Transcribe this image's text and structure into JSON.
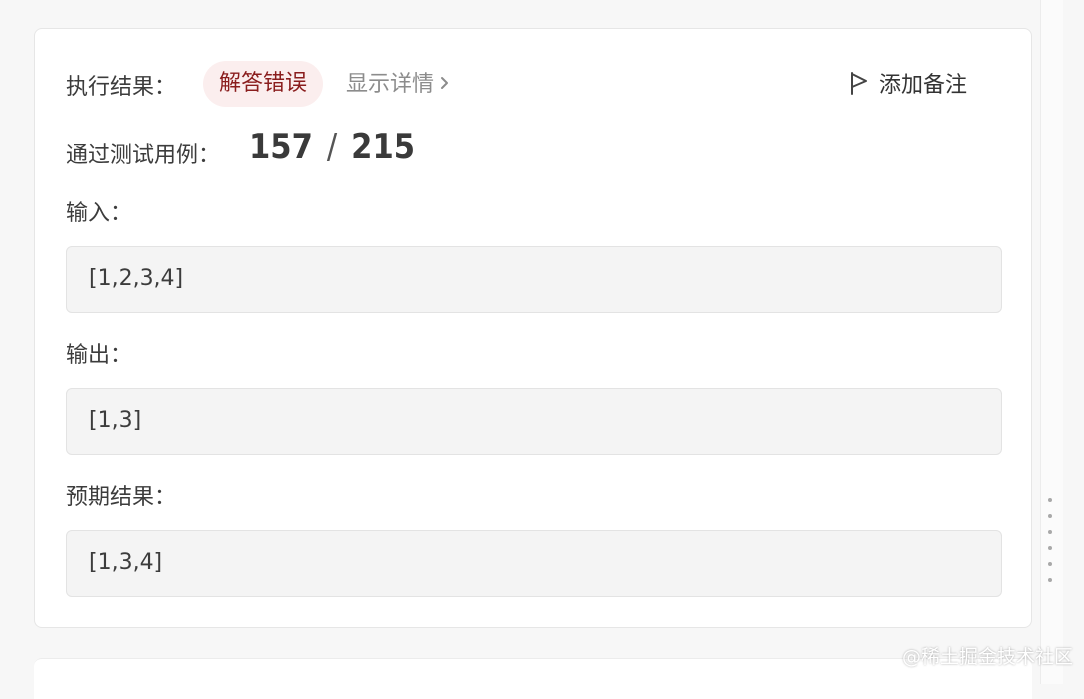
{
  "result": {
    "label": "执行结果：",
    "status": "解答错误",
    "details_link": "显示详情",
    "add_note": "添加备注"
  },
  "tests": {
    "label": "通过测试用例：",
    "passed": "157",
    "separator": "/",
    "total": "215"
  },
  "input": {
    "label": "输入：",
    "value": "[1,2,3,4]"
  },
  "output": {
    "label": "输出：",
    "value": "[1,3]"
  },
  "expected": {
    "label": "预期结果：",
    "value": "[1,3,4]"
  },
  "watermark": "@稀土掘金技术社区",
  "colors": {
    "error_text": "#8a1d1d",
    "error_background": "#fbeeee",
    "box_background": "#f4f4f4"
  }
}
